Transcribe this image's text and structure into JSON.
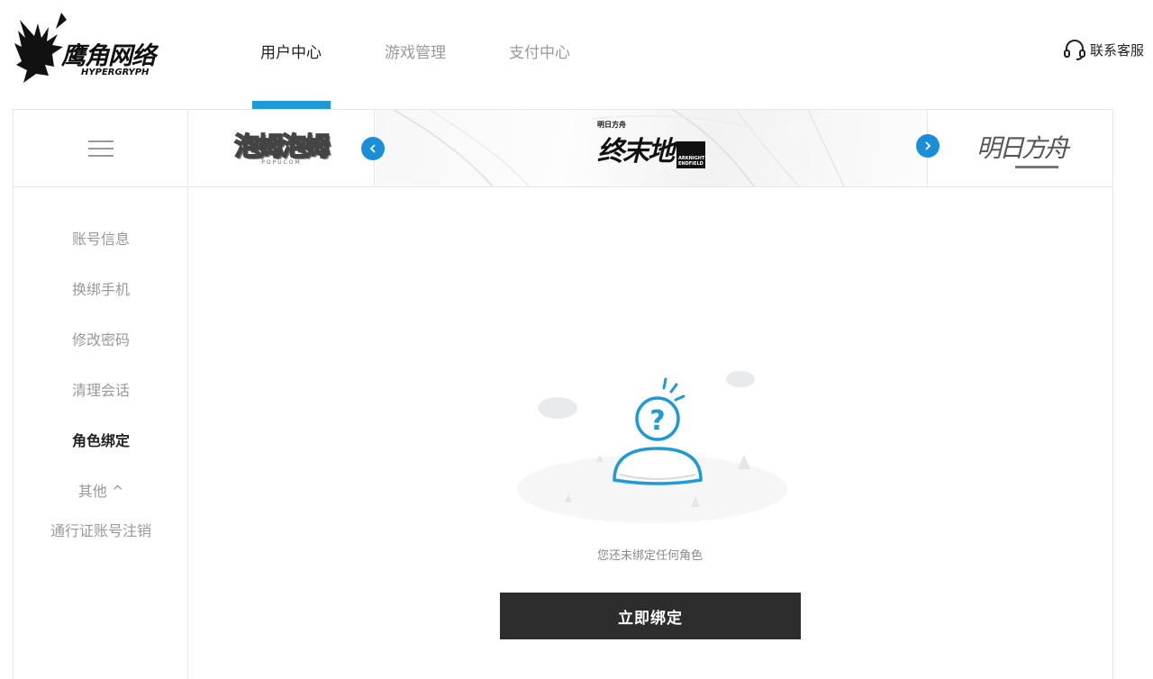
{
  "brand": {
    "name": "鹰角网络",
    "sub": "HYPERGRYPH"
  },
  "nav": {
    "items": [
      {
        "label": "用户中心",
        "active": true
      },
      {
        "label": "游戏管理",
        "active": false
      },
      {
        "label": "支付中心",
        "active": false
      }
    ],
    "support_label": "联系客服",
    "support_icon": "headset-icon"
  },
  "games": {
    "left": {
      "title": "泡姆泡姆",
      "sub": "POPUCOM"
    },
    "center": {
      "top": "明日方舟",
      "title": "终末地",
      "badge_line1": "ARKNIGHTS",
      "badge_line2": "ENDFIELD"
    },
    "right": {
      "title": "明日方舟"
    },
    "prev_icon": "chevron-left-icon",
    "next_icon": "chevron-right-icon",
    "accent": "#1a8fd9"
  },
  "sidebar": {
    "items": [
      {
        "label": "账号信息",
        "active": false
      },
      {
        "label": "换绑手机",
        "active": false
      },
      {
        "label": "修改密码",
        "active": false
      },
      {
        "label": "清理会话",
        "active": false
      },
      {
        "label": "角色绑定",
        "active": true
      },
      {
        "label": "其他 ^",
        "active": false
      },
      {
        "label": "通行证账号注销",
        "active": false
      }
    ]
  },
  "main": {
    "empty_text": "您还未绑定任何角色",
    "bind_button": "立即绑定",
    "illustration_icon": "unknown-user-icon"
  },
  "colors": {
    "accent": "#1e9ad6",
    "button": "#2d2d2d",
    "muted": "#999999"
  }
}
